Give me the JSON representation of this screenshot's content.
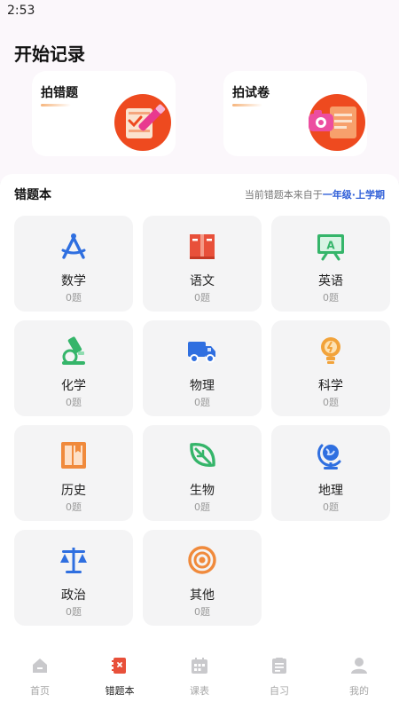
{
  "status": {
    "time": "2:53"
  },
  "hero": {
    "title": "开始记录",
    "cards": [
      {
        "label": "拍错题",
        "icon": "wrong-question-camera-icon"
      },
      {
        "label": "拍试卷",
        "icon": "exam-paper-camera-icon"
      }
    ]
  },
  "notebook": {
    "title": "错题本",
    "hint_prefix": "当前错题本来自于",
    "hint_grade": "一年级·上学期",
    "subjects": [
      {
        "name": "数学",
        "count": "0题",
        "icon": "compass-icon",
        "color": "#2f6fe0"
      },
      {
        "name": "语文",
        "count": "0题",
        "icon": "book-icon",
        "color": "#e8503a"
      },
      {
        "name": "英语",
        "count": "0题",
        "icon": "letter-a-board-icon",
        "color": "#35b56a"
      },
      {
        "name": "化学",
        "count": "0题",
        "icon": "microscope-icon",
        "color": "#35b56a"
      },
      {
        "name": "物理",
        "count": "0题",
        "icon": "truck-icon",
        "color": "#2f6fe0"
      },
      {
        "name": "科学",
        "count": "0题",
        "icon": "lightbulb-icon",
        "color": "#f2a33a"
      },
      {
        "name": "历史",
        "count": "0题",
        "icon": "history-book-icon",
        "color": "#f08a3c"
      },
      {
        "name": "生物",
        "count": "0题",
        "icon": "leaf-icon",
        "color": "#35b56a"
      },
      {
        "name": "地理",
        "count": "0题",
        "icon": "globe-icon",
        "color": "#2f6fe0"
      },
      {
        "name": "政治",
        "count": "0题",
        "icon": "scale-icon",
        "color": "#2f6fe0"
      },
      {
        "name": "其他",
        "count": "0题",
        "icon": "target-icon",
        "color": "#f08a3c"
      }
    ]
  },
  "tabbar": {
    "items": [
      {
        "label": "首页",
        "icon": "home-icon",
        "active": false
      },
      {
        "label": "错题本",
        "icon": "notebook-icon",
        "active": true
      },
      {
        "label": "课表",
        "icon": "calendar-icon",
        "active": false
      },
      {
        "label": "自习",
        "icon": "clipboard-icon",
        "active": false
      },
      {
        "label": "我的",
        "icon": "profile-icon",
        "active": false
      }
    ],
    "active_color": "#e8503a",
    "inactive_color": "#c9c9cc"
  }
}
